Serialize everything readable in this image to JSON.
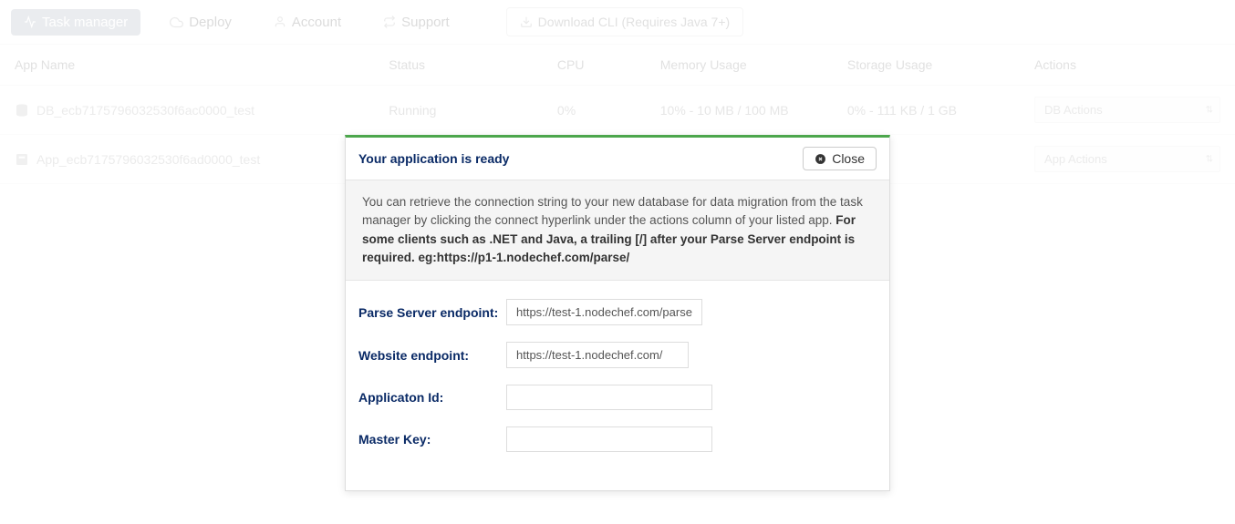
{
  "nav": {
    "task_manager": "Task manager",
    "deploy": "Deploy",
    "account": "Account",
    "support": "Support",
    "download_cli": "Download CLI (Requires Java 7+)"
  },
  "table": {
    "headers": {
      "app_name": "App Name",
      "status": "Status",
      "cpu": "CPU",
      "memory": "Memory Usage",
      "storage": "Storage Usage",
      "actions": "Actions"
    },
    "rows": [
      {
        "name": "DB_ecb7175796032530f6ac0000_test",
        "status": "Running",
        "cpu": "0%",
        "memory": "10% - 10 MB / 100 MB",
        "storage": "0% - 111 KB / 1 GB",
        "action_label": "DB Actions"
      },
      {
        "name": "App_ecb7175796032530f6ad0000_test",
        "status": "",
        "cpu": "",
        "memory": "",
        "storage": "",
        "action_label": "App Actions"
      }
    ]
  },
  "modal": {
    "title": "Your application is ready",
    "close": "Close",
    "info_text": "You can retrieve the connection string to your new database for data migration from the task manager by clicking the connect hyperlink under the actions column of your listed app. ",
    "info_bold": "For some clients such as .NET and Java, a trailing [/] after your Parse Server endpoint is required. eg:https://p1-1.nodechef.com/parse/",
    "fields": {
      "parse_endpoint_label": "Parse Server endpoint:",
      "parse_endpoint_value": "https://test-1.nodechef.com/parse",
      "website_endpoint_label": "Website endpoint:",
      "website_endpoint_value": "https://test-1.nodechef.com/",
      "app_id_label": "Applicaton Id:",
      "app_id_value": "",
      "master_key_label": "Master Key:",
      "master_key_value": ""
    }
  }
}
